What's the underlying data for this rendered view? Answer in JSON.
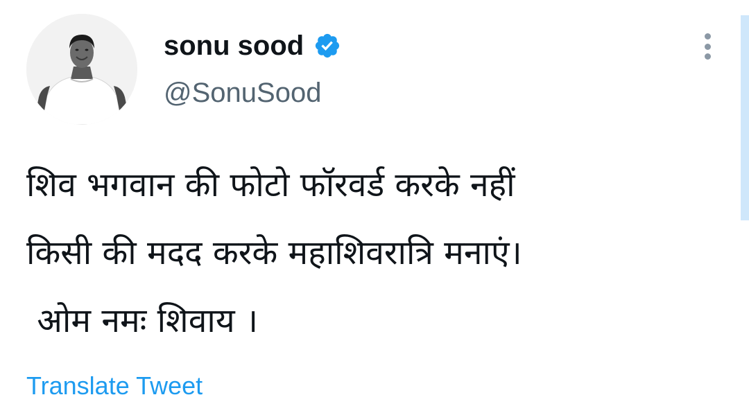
{
  "author": {
    "display_name": "sonu sood",
    "handle": "@SonuSood",
    "verified_icon": "verified-badge-icon",
    "avatar_icon": "profile-avatar"
  },
  "menu": {
    "icon": "more-vertical-icon"
  },
  "tweet": {
    "lines": [
      "शिव भगवान की फोटो फॉरवर्ड करके नहीं",
      "किसी की मदद करके महाशिवरात्रि मनाएं।",
      " ओम नमः शिवाय ।"
    ]
  },
  "actions": {
    "translate_label": "Translate Tweet"
  },
  "colors": {
    "accent": "#1d9bf0",
    "text_primary": "#0f1419",
    "text_secondary": "#536471"
  }
}
